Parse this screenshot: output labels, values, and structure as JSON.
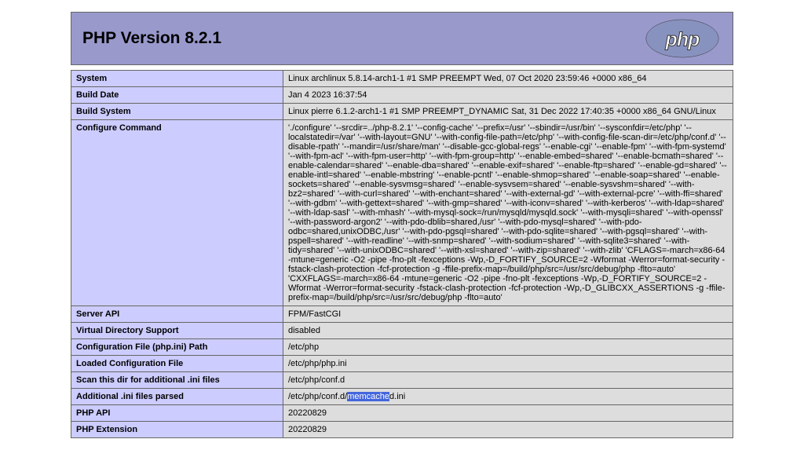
{
  "title": "PHP Version 8.2.1",
  "logo_text": "php",
  "rows": [
    {
      "key": "System",
      "value": "Linux archlinux 5.8.14-arch1-1 #1 SMP PREEMPT Wed, 07 Oct 2020 23:59:46 +0000 x86_64"
    },
    {
      "key": "Build Date",
      "value": "Jan 4 2023 16:37:54"
    },
    {
      "key": "Build System",
      "value": "Linux pierre 6.1.2-arch1-1 #1 SMP PREEMPT_DYNAMIC Sat, 31 Dec 2022 17:40:35 +0000 x86_64 GNU/Linux"
    },
    {
      "key": "Configure Command",
      "value": "'./configure' '--srcdir=../php-8.2.1' '--config-cache' '--prefix=/usr' '--sbindir=/usr/bin' '--sysconfdir=/etc/php' '--localstatedir=/var' '--with-layout=GNU' '--with-config-file-path=/etc/php' '--with-config-file-scan-dir=/etc/php/conf.d' '--disable-rpath' '--mandir=/usr/share/man' '--disable-gcc-global-regs' '--enable-cgi' '--enable-fpm' '--with-fpm-systemd' '--with-fpm-acl' '--with-fpm-user=http' '--with-fpm-group=http' '--enable-embed=shared' '--enable-bcmath=shared' '--enable-calendar=shared' '--enable-dba=shared' '--enable-exif=shared' '--enable-ftp=shared' '--enable-gd=shared' '--enable-intl=shared' '--enable-mbstring' '--enable-pcntl' '--enable-shmop=shared' '--enable-soap=shared' '--enable-sockets=shared' '--enable-sysvmsg=shared' '--enable-sysvsem=shared' '--enable-sysvshm=shared' '--with-bz2=shared' '--with-curl=shared' '--with-enchant=shared' '--with-external-gd' '--with-external-pcre' '--with-ffi=shared' '--with-gdbm' '--with-gettext=shared' '--with-gmp=shared' '--with-iconv=shared' '--with-kerberos' '--with-ldap=shared' '--with-ldap-sasl' '--with-mhash' '--with-mysql-sock=/run/mysqld/mysqld.sock' '--with-mysqli=shared' '--with-openssl' '--with-password-argon2' '--with-pdo-dblib=shared,/usr' '--with-pdo-mysql=shared' '--with-pdo-odbc=shared,unixODBC,/usr' '--with-pdo-pgsql=shared' '--with-pdo-sqlite=shared' '--with-pgsql=shared' '--with-pspell=shared' '--with-readline' '--with-snmp=shared' '--with-sodium=shared' '--with-sqlite3=shared' '--with-tidy=shared' '--with-unixODBC=shared' '--with-xsl=shared' '--with-zip=shared' '--with-zlib' 'CFLAGS=-march=x86-64 -mtune=generic -O2 -pipe -fno-plt -fexceptions -Wp,-D_FORTIFY_SOURCE=2 -Wformat -Werror=format-security -fstack-clash-protection -fcf-protection -g -ffile-prefix-map=/build/php/src=/usr/src/debug/php -flto=auto' 'CXXFLAGS=-march=x86-64 -mtune=generic -O2 -pipe -fno-plt -fexceptions -Wp,-D_FORTIFY_SOURCE=2 -Wformat -Werror=format-security -fstack-clash-protection -fcf-protection -Wp,-D_GLIBCXX_ASSERTIONS -g -ffile-prefix-map=/build/php/src=/usr/src/debug/php -flto=auto'"
    },
    {
      "key": "Server API",
      "value": "FPM/FastCGI"
    },
    {
      "key": "Virtual Directory Support",
      "value": "disabled"
    },
    {
      "key": "Configuration File (php.ini) Path",
      "value": "/etc/php"
    },
    {
      "key": "Loaded Configuration File",
      "value": "/etc/php/php.ini"
    },
    {
      "key": "Scan this dir for additional .ini files",
      "value": "/etc/php/conf.d"
    },
    {
      "key": "Additional .ini files parsed",
      "value_prefix": "/etc/php/conf.d/",
      "value_highlight": "memcache",
      "value_suffix": "d.ini"
    },
    {
      "key": "PHP API",
      "value": "20220829"
    },
    {
      "key": "PHP Extension",
      "value": "20220829"
    }
  ]
}
